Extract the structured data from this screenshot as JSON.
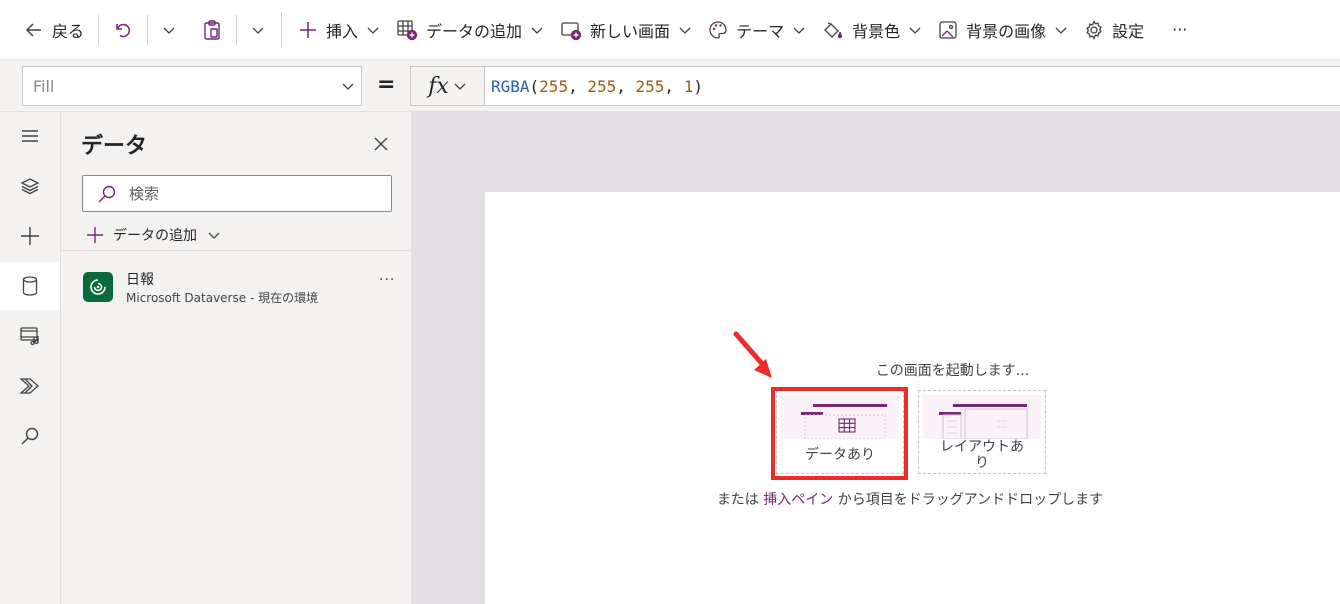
{
  "commandbar": {
    "back_label": "戻る",
    "insert_label": "挿入",
    "add_data_label": "データの追加",
    "new_screen_label": "新しい画面",
    "theme_label": "テーマ",
    "background_color_label": "背景色",
    "background_image_label": "背景の画像",
    "settings_label": "設定",
    "more_label": "···"
  },
  "formula_bar": {
    "property": "Fill",
    "equals": "=",
    "fx_label": "fx",
    "formula": {
      "fn": "RGBA",
      "open": "(",
      "r": "255",
      "sep1": ", ",
      "g": "255",
      "sep2": ", ",
      "b": "255",
      "sep3": ", ",
      "a": "1",
      "close": ")"
    }
  },
  "rail": {
    "items": [
      "menu-icon",
      "layers-icon",
      "plus-icon",
      "database-icon",
      "media-icon",
      "power-automate-icon",
      "search-icon"
    ],
    "active": "database-icon"
  },
  "data_panel": {
    "title": "データ",
    "search_placeholder": "検索",
    "add_data_label": "データの追加",
    "sources": [
      {
        "name": "日報",
        "subtitle": "Microsoft Dataverse - 現在の環境",
        "more": "···"
      }
    ]
  },
  "canvas": {
    "start_prompt": "この画面を起動します...",
    "cards": [
      {
        "label": "データあり"
      },
      {
        "label_line1": "レイアウトあ",
        "label_line2": "り"
      }
    ],
    "footer_prefix": "または",
    "footer_link": "挿入ペイン",
    "footer_suffix": "から項目をドラッグアンドドロップします"
  },
  "colors": {
    "accent": "#742774",
    "highlight": "#ee2b2b",
    "dataverse": "#0b6a3b",
    "canvas_bg": "#e1dfe3"
  }
}
